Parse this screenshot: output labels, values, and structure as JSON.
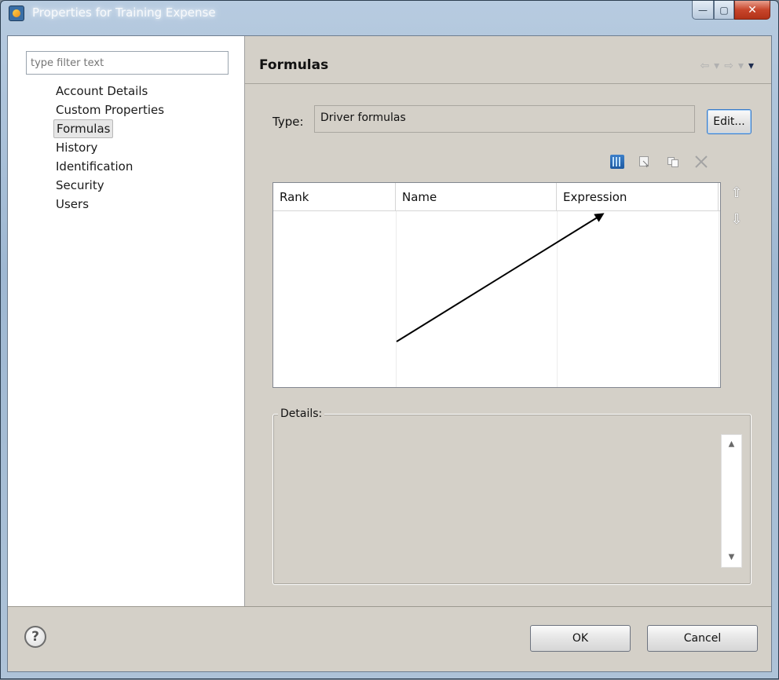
{
  "window": {
    "title": "Properties for Training Expense",
    "minimize_glyph": "—",
    "maximize_glyph": "▢",
    "close_glyph": "✕"
  },
  "sidebar": {
    "filter_placeholder": "type filter text",
    "items": [
      {
        "label": "Account Details",
        "selected": false
      },
      {
        "label": "Custom Properties",
        "selected": false
      },
      {
        "label": "Formulas",
        "selected": true
      },
      {
        "label": "History",
        "selected": false
      },
      {
        "label": "Identification",
        "selected": false
      },
      {
        "label": "Security",
        "selected": false
      },
      {
        "label": "Users",
        "selected": false
      }
    ]
  },
  "page": {
    "title": "Formulas",
    "nav_back": "⇦",
    "nav_forward": "⇨",
    "nav_menu": "▾",
    "type_label": "Type:",
    "type_value": "Driver formulas",
    "edit_label": "Edit...",
    "toolbar_icons": [
      "new-formula-icon",
      "edit-formula-icon",
      "copy-formula-icon",
      "delete-formula-icon"
    ],
    "table": {
      "columns": [
        "Rank",
        "Name",
        "Expression"
      ],
      "rows": []
    },
    "move_up_glyph": "⇧",
    "move_down_glyph": "⇩",
    "details_label": "Details:",
    "details_text": ""
  },
  "footer": {
    "help_glyph": "?",
    "ok_label": "OK",
    "cancel_label": "Cancel"
  },
  "colors": {
    "dialog_background": "#d4d0c8",
    "close_button": "#c7452b",
    "title_bar": "#9fb8d2"
  }
}
